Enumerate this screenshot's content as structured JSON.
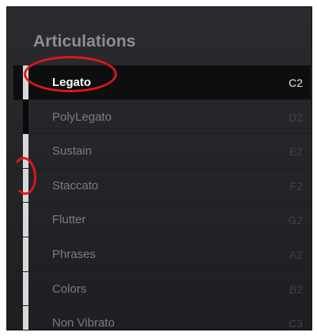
{
  "panel": {
    "title": "Articulations"
  },
  "articulations": [
    {
      "label": "Legato",
      "note": "C2",
      "active": true
    },
    {
      "label": "PolyLegato",
      "note": "D2",
      "active": false
    },
    {
      "label": "Sustain",
      "note": "E2",
      "active": false
    },
    {
      "label": "Staccato",
      "note": "F2",
      "active": false
    },
    {
      "label": "Flutter",
      "note": "G2",
      "active": false
    },
    {
      "label": "Phrases",
      "note": "A2",
      "active": false
    },
    {
      "label": "Colors",
      "note": "B2",
      "active": false
    },
    {
      "label": "Non Vibrato",
      "note": "C3",
      "active": false
    }
  ],
  "colors": {
    "annotation": "#e0151b",
    "active_text": "#ffffff",
    "inactive_text": "#7b7d82"
  }
}
